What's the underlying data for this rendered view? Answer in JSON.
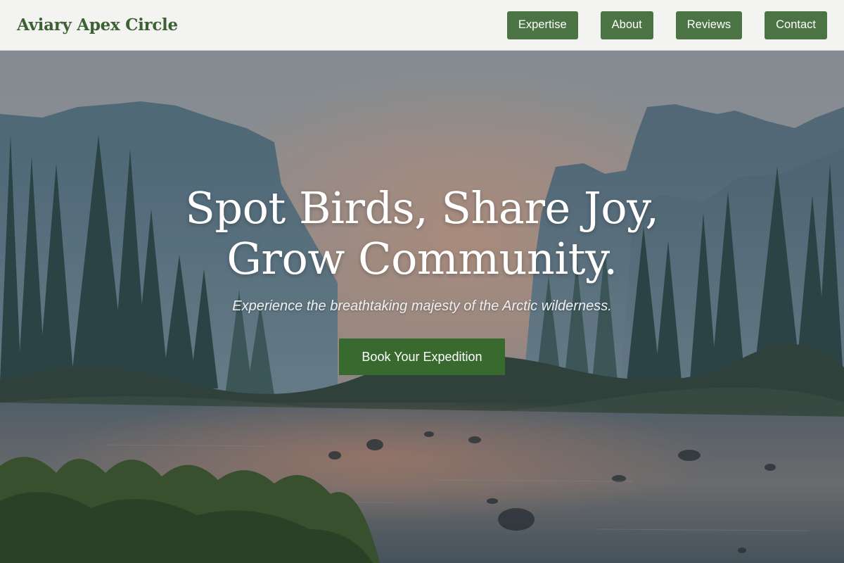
{
  "brand": {
    "name": "Aviary Apex Circle"
  },
  "nav": {
    "items": [
      {
        "label": "Expertise"
      },
      {
        "label": "About"
      },
      {
        "label": "Reviews"
      },
      {
        "label": "Contact"
      }
    ]
  },
  "hero": {
    "title_line1": "Spot Birds, Share Joy,",
    "title_line2": "Grow Community.",
    "subtitle": "Experience the breathtaking majesty of the Arctic wilderness.",
    "cta_label": "Book Your Expedition"
  },
  "colors": {
    "accent": "#4b7344",
    "cta": "#386a30",
    "brand_text": "#3c6233",
    "navbar_bg": "#f3f3f1"
  }
}
